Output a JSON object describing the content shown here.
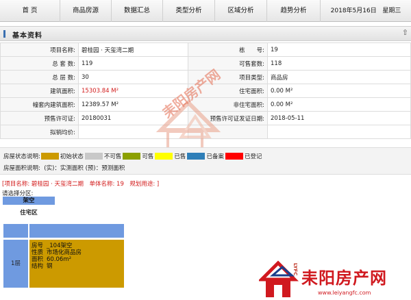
{
  "nav": {
    "items": [
      "首 页",
      "商品房源",
      "数据汇总",
      "类型分析",
      "区域分析",
      "趋势分析"
    ],
    "date": "2018年5月16日",
    "weekday": "星期三"
  },
  "section": {
    "title": "基本资料"
  },
  "info": {
    "rows": [
      {
        "l1": "项目名称:",
        "v1": "碧桂园 · 天玺湾二期",
        "l2": "栋　　号:",
        "v2": "19"
      },
      {
        "l1": "总 套 数:",
        "v1": "119",
        "l2": "可售套数:",
        "v2": "118"
      },
      {
        "l1": "总 层 数:",
        "v1": "30",
        "l2": "项目类型:",
        "v2": "商品房"
      },
      {
        "l1": "建筑面积:",
        "v1": "15303.84 M²",
        "l2": "住宅面积:",
        "v2": "0.00 M²"
      },
      {
        "l1": "幢套内建筑面积:",
        "v1": "12389.57 M²",
        "l2": "非住宅面积:",
        "v2": "0.00 M²"
      },
      {
        "l1": "预售许可证:",
        "v1": "20180031",
        "l2": "预售许可证发证日期:",
        "v2": "2018-05-11"
      },
      {
        "l1": "拟销均价:",
        "v1": "",
        "l2": "",
        "v2": ""
      }
    ]
  },
  "legend": {
    "label": "房屋状态说明:",
    "items": [
      {
        "color": "#cc9a00",
        "text": "初始状态"
      },
      {
        "color": "#c8c8c8",
        "text": "不可售"
      },
      {
        "color": "#8ca000",
        "text": "可售"
      },
      {
        "color": "#ffff00",
        "text": "已售"
      },
      {
        "color": "#2f7fb8",
        "text": "已备案"
      },
      {
        "color": "#ff0000",
        "text": "已登记"
      }
    ],
    "area_label": "房屋面积说明:",
    "area_text": "(实)：实测面积 (预)：预测面积"
  },
  "unit": {
    "line": "[项目名称: 碧桂园 · 天玺湾二期　单体名称: 19　规划用途: ]",
    "choose": "请选择分区:"
  },
  "zone": {
    "top": "架空",
    "label": "住宅区",
    "floor": "1层",
    "room": {
      "fields": [
        {
          "k": "房号",
          "v": "_104架空"
        },
        {
          "k": "性质",
          "v": "市场化商品房"
        },
        {
          "k": "面积",
          "v": "60.06m²"
        },
        {
          "k": "结构",
          "v": "钢"
        }
      ]
    }
  },
  "watermark": {
    "center": "耒阳房产网",
    "brand": "耒阳房产网",
    "side": "LYFC",
    "url": "www.leiyangfc.com"
  }
}
